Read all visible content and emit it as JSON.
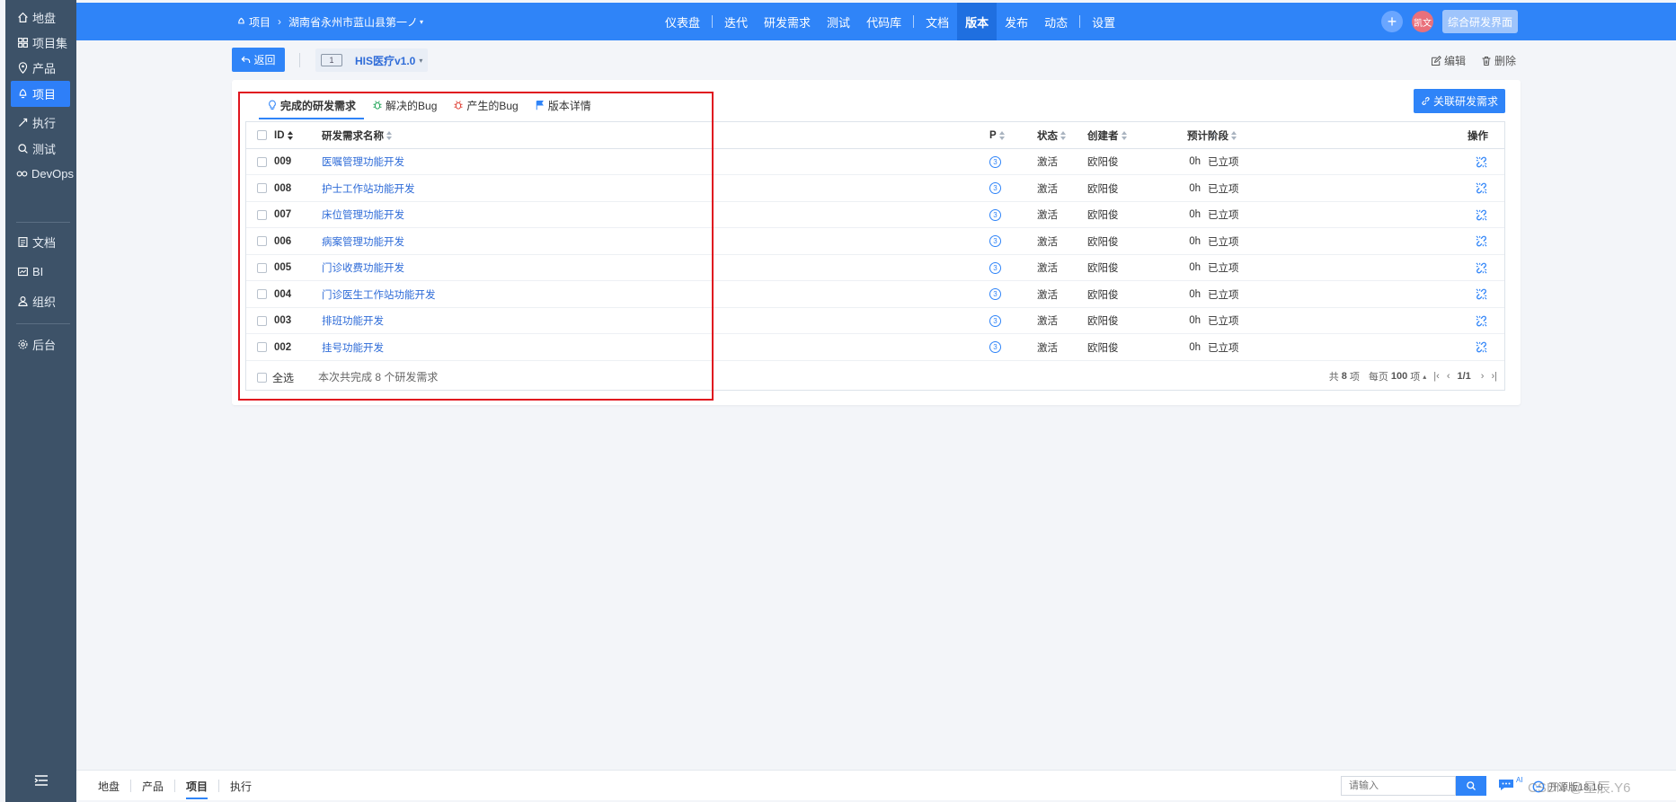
{
  "sidebar": {
    "items": [
      {
        "label": "地盘",
        "icon": "home-icon"
      },
      {
        "label": "项目集",
        "icon": "grid-icon"
      },
      {
        "label": "产品",
        "icon": "product-icon"
      },
      {
        "label": "项目",
        "icon": "project-icon",
        "active": true
      },
      {
        "label": "执行",
        "icon": "execution-icon"
      },
      {
        "label": "测试",
        "icon": "test-icon"
      },
      {
        "label": "DevOps",
        "icon": "devops-icon"
      },
      {
        "label": "文档",
        "icon": "doc-icon"
      },
      {
        "label": "BI",
        "icon": "bi-icon"
      },
      {
        "label": "组织",
        "icon": "org-icon"
      },
      {
        "label": "后台",
        "icon": "admin-icon"
      }
    ]
  },
  "header": {
    "breadcrumb_root": "项目",
    "breadcrumb_project": "湖南省永州市蓝山县第一ノ",
    "nav": [
      {
        "label": "仪表盘"
      },
      {
        "label": "迭代"
      },
      {
        "label": "研发需求"
      },
      {
        "label": "测试"
      },
      {
        "label": "代码库"
      },
      {
        "label": "文档"
      },
      {
        "label": "版本",
        "active": true
      },
      {
        "label": "发布"
      },
      {
        "label": "动态"
      },
      {
        "label": "设置"
      }
    ],
    "plus": "+",
    "avatar": "凯文",
    "view_button": "综合研发界面"
  },
  "toolbar": {
    "back": "返回",
    "version_badge": "1",
    "version_name": "HIS医疗v1.0",
    "edit": "编辑",
    "delete": "删除"
  },
  "tabs": [
    {
      "label": "完成的研发需求",
      "icon": "bulb-icon",
      "active": true
    },
    {
      "label": "解决的Bug",
      "icon": "bug-icon"
    },
    {
      "label": "产生的Bug",
      "icon": "bug-icon"
    },
    {
      "label": "版本详情",
      "icon": "flag-icon"
    }
  ],
  "link_button": "关联研发需求",
  "table": {
    "columns": {
      "id": "ID",
      "name": "研发需求名称",
      "pri": "P",
      "status": "状态",
      "creator": "创建者",
      "estimate": "预计",
      "stage": "阶段",
      "actions": "操作"
    },
    "rows": [
      {
        "id": "009",
        "name": "医嘱管理功能开发",
        "pri": "3",
        "status": "激活",
        "creator": "欧阳俊",
        "estimate": "0h",
        "stage": "已立项"
      },
      {
        "id": "008",
        "name": "护士工作站功能开发",
        "pri": "3",
        "status": "激活",
        "creator": "欧阳俊",
        "estimate": "0h",
        "stage": "已立项"
      },
      {
        "id": "007",
        "name": "床位管理功能开发",
        "pri": "3",
        "status": "激活",
        "creator": "欧阳俊",
        "estimate": "0h",
        "stage": "已立项"
      },
      {
        "id": "006",
        "name": "病案管理功能开发",
        "pri": "3",
        "status": "激活",
        "creator": "欧阳俊",
        "estimate": "0h",
        "stage": "已立项"
      },
      {
        "id": "005",
        "name": "门诊收费功能开发",
        "pri": "3",
        "status": "激活",
        "creator": "欧阳俊",
        "estimate": "0h",
        "stage": "已立项"
      },
      {
        "id": "004",
        "name": "门诊医生工作站功能开发",
        "pri": "3",
        "status": "激活",
        "creator": "欧阳俊",
        "estimate": "0h",
        "stage": "已立项"
      },
      {
        "id": "003",
        "name": "排班功能开发",
        "pri": "3",
        "status": "激活",
        "creator": "欧阳俊",
        "estimate": "0h",
        "stage": "已立项"
      },
      {
        "id": "002",
        "name": "挂号功能开发",
        "pri": "3",
        "status": "激活",
        "creator": "欧阳俊",
        "estimate": "0h",
        "stage": "已立项"
      }
    ],
    "footer": {
      "select_all": "全选",
      "summary": "本次共完成 8 个研发需求",
      "total_prefix": "共",
      "total_count": "8",
      "total_suffix": "项",
      "per_page_prefix": "每页",
      "per_page": "100",
      "per_page_suffix": "项",
      "page": "1/1"
    }
  },
  "bottombar": {
    "nav": [
      {
        "label": "地盘"
      },
      {
        "label": "产品"
      },
      {
        "label": "项目",
        "active": true
      },
      {
        "label": "执行"
      }
    ],
    "search_placeholder": "请输入",
    "ai_label": "AI",
    "version_text": "开源版18.10"
  },
  "watermark": "CSDN @星辰.Y6"
}
